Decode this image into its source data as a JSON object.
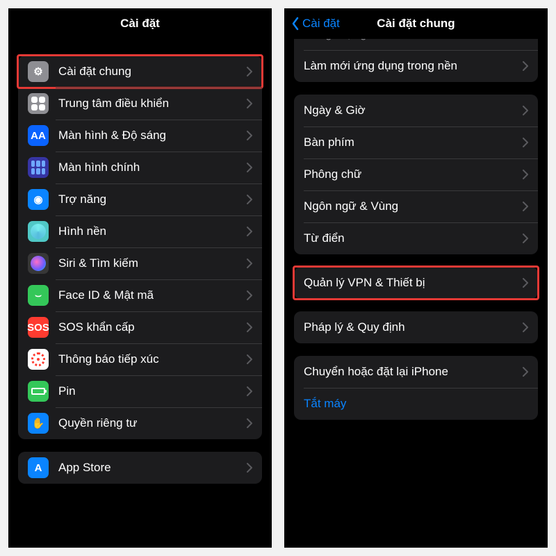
{
  "left": {
    "title": "Cài đặt",
    "groups": [
      {
        "items": [
          {
            "id": "general",
            "icon": "gear-icon",
            "label": "Cài đặt chung",
            "highlight": true
          },
          {
            "id": "control",
            "icon": "control-center-icon",
            "label": "Trung tâm điều khiển"
          },
          {
            "id": "display",
            "icon": "display-icon",
            "label": "Màn hình & Độ sáng"
          },
          {
            "id": "home",
            "icon": "home-screen-icon",
            "label": "Màn hình chính"
          },
          {
            "id": "access",
            "icon": "accessibility-icon",
            "label": "Trợ năng"
          },
          {
            "id": "wall",
            "icon": "wallpaper-icon",
            "label": "Hình nền"
          },
          {
            "id": "siri",
            "icon": "siri-icon",
            "label": "Siri & Tìm kiếm"
          },
          {
            "id": "face",
            "icon": "face-id-icon",
            "label": "Face ID & Mật mã"
          },
          {
            "id": "sos",
            "icon": "sos-icon",
            "label": "SOS khẩn cấp"
          },
          {
            "id": "expo",
            "icon": "exposure-icon",
            "label": "Thông báo tiếp xúc"
          },
          {
            "id": "batt",
            "icon": "battery-icon",
            "label": "Pin"
          },
          {
            "id": "priv",
            "icon": "privacy-icon",
            "label": "Quyền riêng tư"
          }
        ]
      },
      {
        "items": [
          {
            "id": "store",
            "icon": "app-store-icon",
            "label": "App Store"
          }
        ]
      }
    ]
  },
  "right": {
    "back": "Cài đặt",
    "title": "Cài đặt chung",
    "groups": [
      {
        "partialTop": true,
        "items": [
          {
            "id": "storage",
            "label": "Dung lượng iPhone",
            "partial": true
          },
          {
            "id": "bgapp",
            "label": "Làm mới ứng dụng trong nền"
          }
        ]
      },
      {
        "items": [
          {
            "id": "date",
            "label": "Ngày & Giờ"
          },
          {
            "id": "kbd",
            "label": "Bàn phím"
          },
          {
            "id": "font",
            "label": "Phông chữ"
          },
          {
            "id": "lang",
            "label": "Ngôn ngữ & Vùng"
          },
          {
            "id": "dict",
            "label": "Từ điển"
          }
        ]
      },
      {
        "items": [
          {
            "id": "vpn",
            "label": "Quản lý VPN & Thiết bị",
            "highlight": true
          }
        ]
      },
      {
        "items": [
          {
            "id": "legal",
            "label": "Pháp lý & Quy định"
          }
        ]
      },
      {
        "items": [
          {
            "id": "reset",
            "label": "Chuyển hoặc đặt lại iPhone"
          },
          {
            "id": "shut",
            "label": "Tắt máy",
            "link": true,
            "nochev": true
          }
        ]
      }
    ]
  },
  "iconText": {
    "gear-icon": "⚙︎",
    "display-icon": "AA",
    "accessibility-icon": "◉",
    "face-id-icon": "⌣",
    "sos-icon": "SOS",
    "privacy-icon": "✋",
    "app-store-icon": "A"
  }
}
